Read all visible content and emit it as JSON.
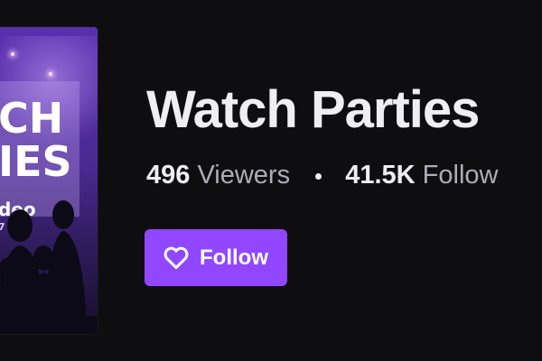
{
  "category": {
    "title": "Watch Parties",
    "box_art": {
      "lines": [
        "CH",
        "IES",
        "deo",
        "7"
      ]
    },
    "viewers": {
      "count": "496",
      "label": "Viewers"
    },
    "followers": {
      "count": "41.5K",
      "label": "Follow"
    }
  },
  "actions": {
    "follow_label": "Follow",
    "follow_icon": "heart-icon"
  },
  "colors": {
    "background": "#0e0e10",
    "accent": "#9147ff",
    "text": "#efeff1",
    "muted": "#adadb8"
  }
}
